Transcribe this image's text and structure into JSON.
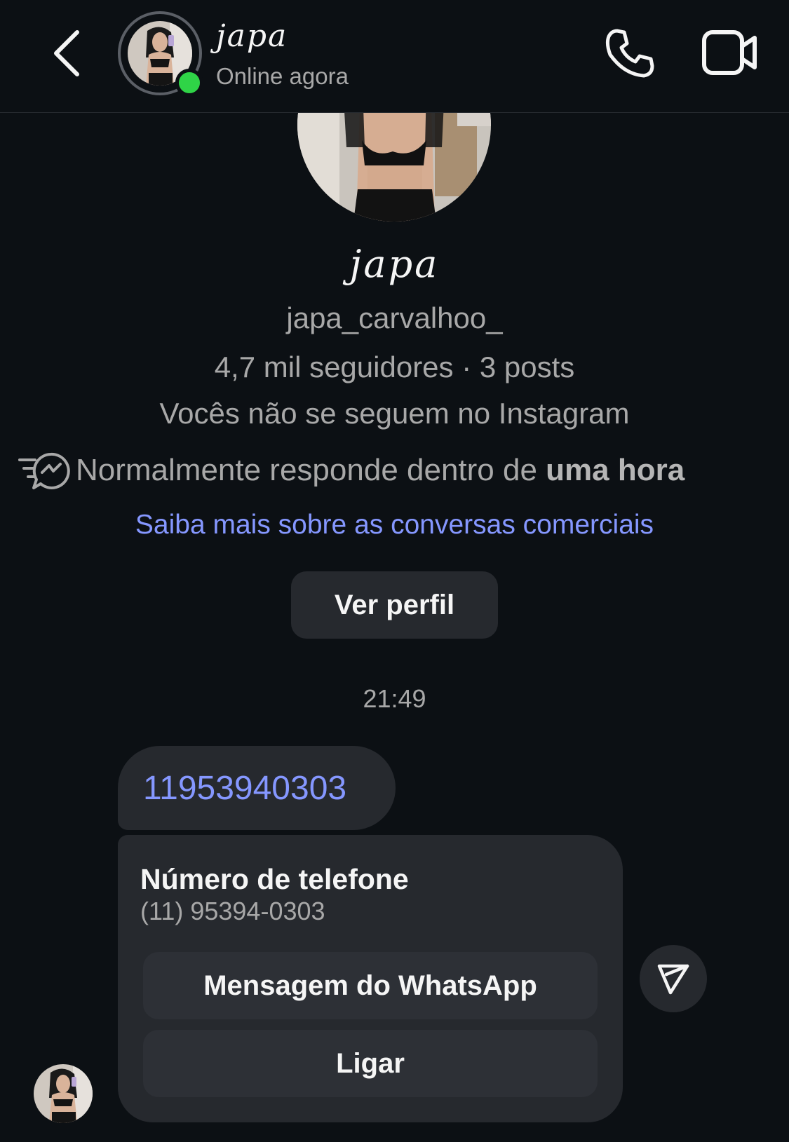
{
  "header": {
    "name": "japa",
    "status": "Online agora",
    "icons": {
      "back": "chevron-left-icon",
      "call": "phone-icon",
      "video": "video-camera-icon",
      "online": "online-dot"
    }
  },
  "profile": {
    "name": "japa",
    "username": "japa_carvalhoo_",
    "stats": "4,7 mil seguidores · 3 posts",
    "follow_status": "Vocês não se seguem no Instagram",
    "response_prefix": "Normalmente responde dentro de ",
    "response_time": "uma hora",
    "business_link": "Saiba mais sobre as conversas comerciais",
    "view_profile_label": "Ver perfil"
  },
  "conversation": {
    "timestamp": "21:49",
    "message_number": "11953940303",
    "phone_card": {
      "title": "Número de telefone",
      "number": "(11) 95394-0303",
      "whatsapp_label": "Mensagem do WhatsApp",
      "call_label": "Ligar"
    }
  },
  "colors": {
    "background": "#0c1014",
    "bubble": "#26292e",
    "link": "#8597ff",
    "online": "#2fd447",
    "secondary_text": "#a8a8a8"
  }
}
